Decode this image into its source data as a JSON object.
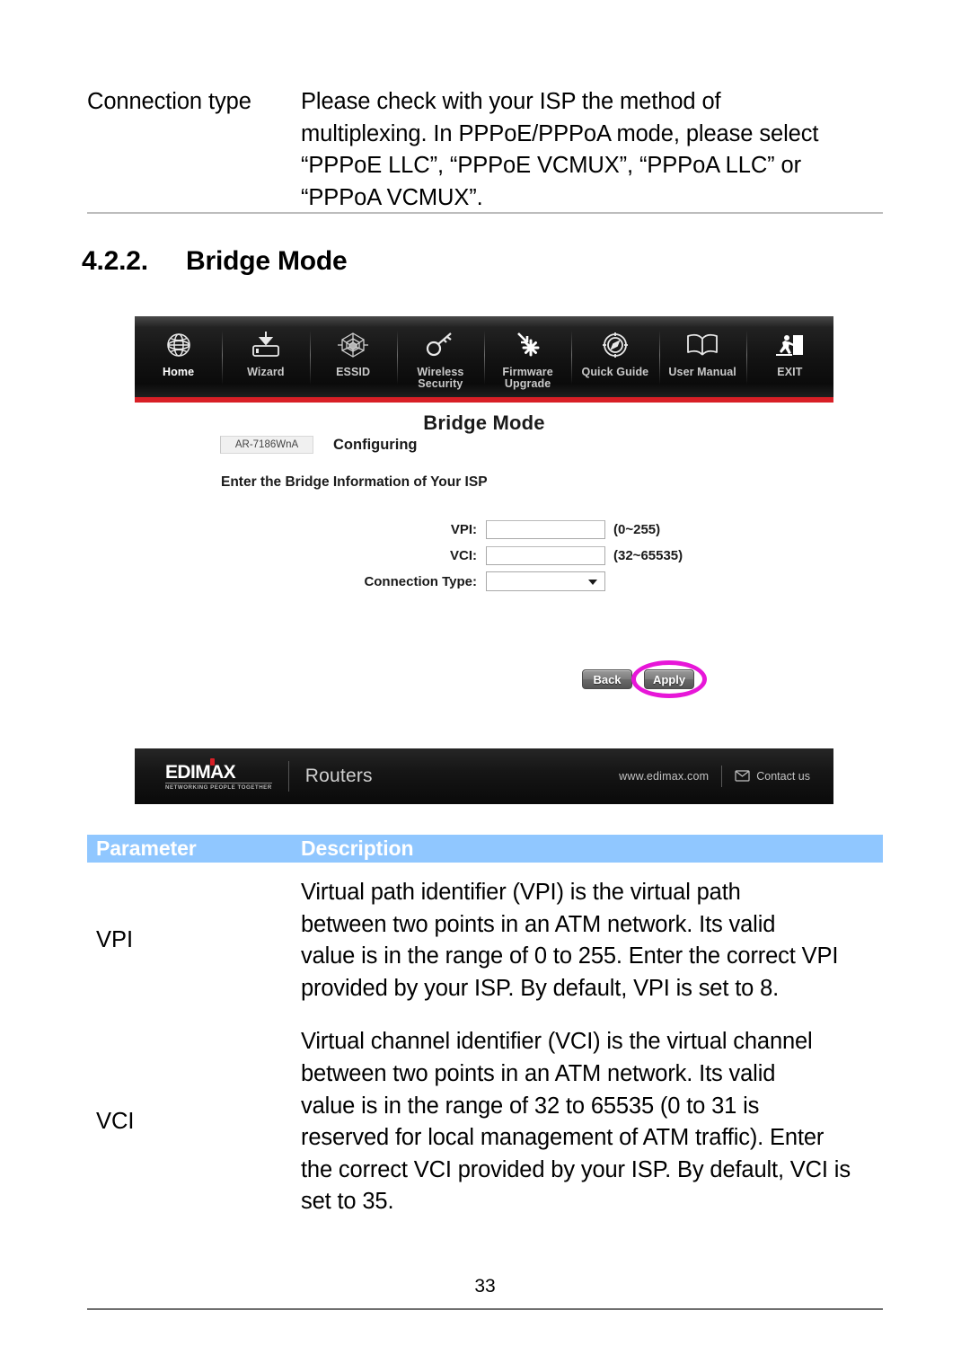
{
  "intro_row": {
    "parameter": "Connection type",
    "description_lines": [
      "Please check with your ISP the method of",
      "multiplexing. In PPPoE/PPPoA mode, please select",
      "“PPPoE LLC”, “PPPoE VCMUX”, “PPPoA LLC” or",
      "“PPPoA VCMUX”."
    ]
  },
  "section": {
    "number": "4.2.2.",
    "title": "Bridge Mode"
  },
  "screenshot": {
    "nav": [
      {
        "label_line1": "Home",
        "label_line2": "",
        "icon": "globe-icon",
        "active": true
      },
      {
        "label_line1": "Wizard",
        "label_line2": "",
        "icon": "device-download-icon",
        "active": false
      },
      {
        "label_line1": "ESSID",
        "label_line2": "",
        "icon": "hex-web-icon",
        "active": false
      },
      {
        "label_line1": "Wireless",
        "label_line2": "Security",
        "icon": "key-icon",
        "active": false
      },
      {
        "label_line1": "Firmware",
        "label_line2": "Upgrade",
        "icon": "firmware-upgrade-icon",
        "active": false
      },
      {
        "label_line1": "Quick Guide",
        "label_line2": "",
        "icon": "compass-icon",
        "active": false
      },
      {
        "label_line1": "User Manual",
        "label_line2": "",
        "icon": "open-book-icon",
        "active": false
      },
      {
        "label_line1": "EXIT",
        "label_line2": "",
        "icon": "exit-running-man-icon",
        "active": false
      }
    ],
    "page_title": "Bridge Mode",
    "model": "AR-7186WnA",
    "status": "Configuring",
    "instruction": "Enter the Bridge Information of Your ISP",
    "fields": [
      {
        "label": "VPI:",
        "value": "",
        "hint": "(0~255)",
        "type": "text"
      },
      {
        "label": "VCI:",
        "value": "",
        "hint": "(32~65535)",
        "type": "text"
      },
      {
        "label": "Connection Type:",
        "value": "",
        "hint": "",
        "type": "select"
      }
    ],
    "buttons": {
      "back": "Back",
      "apply": "Apply"
    },
    "highlight_color": "#e716d8",
    "accent_color": "#d81f26",
    "footer": {
      "logo": "EDIMAX",
      "tagline": "NETWORKING PEOPLE TOGETHER",
      "category": "Routers",
      "url": "www.edimax.com",
      "contact": "Contact us"
    }
  },
  "table": {
    "headers": {
      "parameter": "Parameter",
      "description": "Description"
    },
    "header_color": "#90c7ff",
    "rows": [
      {
        "parameter": "VPI",
        "description_lines": [
          "Virtual path identifier (VPI) is the virtual path",
          "between two points in an ATM network. Its valid",
          "value is in the range of 0 to 255. Enter the correct VPI",
          "provided by your ISP. By default, VPI is set to 8."
        ]
      },
      {
        "parameter": "VCI",
        "description_lines": [
          "Virtual channel identifier (VCI) is the virtual channel",
          "between two points in an ATM network. Its valid",
          "value is in the range of 32 to 65535 (0 to 31 is",
          "reserved for local management of ATM traffic). Enter",
          "the correct VCI provided by your ISP. By default, VCI is",
          "set to 35."
        ]
      }
    ]
  },
  "page_number": "33"
}
